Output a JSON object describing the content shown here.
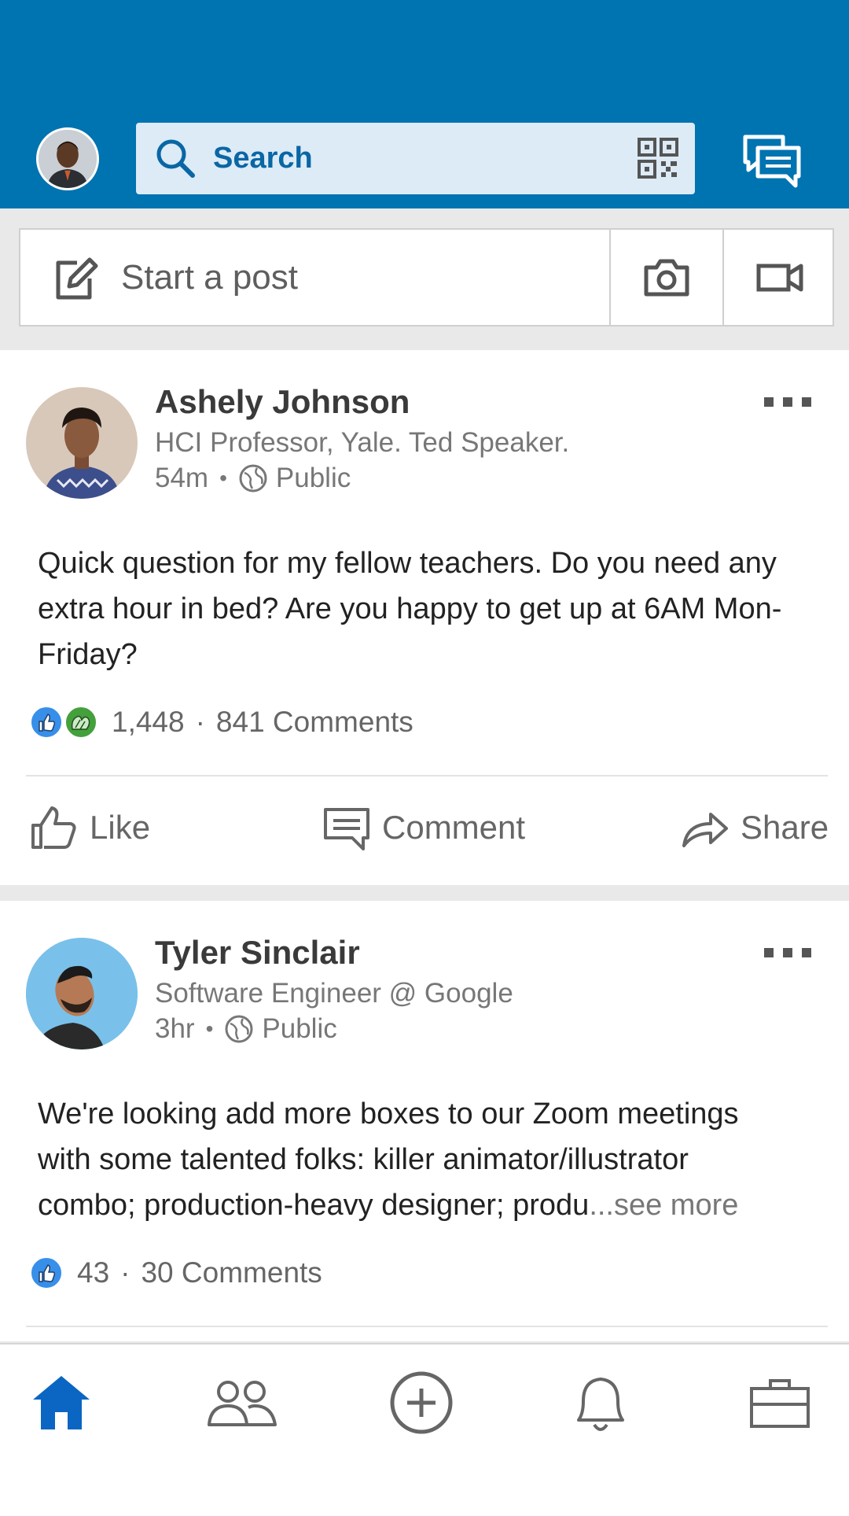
{
  "header": {
    "search_placeholder": "Search"
  },
  "sharebox": {
    "start_label": "Start a post"
  },
  "posts": [
    {
      "author": "Ashely Johnson",
      "headline": "HCI Professor, Yale. Ted Speaker.",
      "time": "54m",
      "visibility": "Public",
      "text": "Quick question for my fellow teachers. Do you need any extra hour in bed? Are you happy to get up at 6AM Mon-Friday?",
      "reaction_count": "1,448",
      "comments": "841 Comments",
      "reactions": [
        "like-icon",
        "celebrate-icon"
      ]
    },
    {
      "author": "Tyler Sinclair",
      "headline": "Software Engineer @ Google",
      "time": "3hr",
      "visibility": "Public",
      "text": "We're looking add more boxes to our Zoom meetings with some talented folks: killer animator/illustrator combo; production-heavy designer; produ",
      "see_more": "...see more",
      "reaction_count": "43",
      "comments": "30 Comments",
      "reactions": [
        "like-icon"
      ]
    }
  ],
  "actions": {
    "like": "Like",
    "comment": "Comment",
    "share": "Share"
  },
  "colors": {
    "brand": "#0073b1",
    "search_bg": "#dcebf6",
    "nav_active": "#0a66c2",
    "nav_inactive": "#666666"
  }
}
